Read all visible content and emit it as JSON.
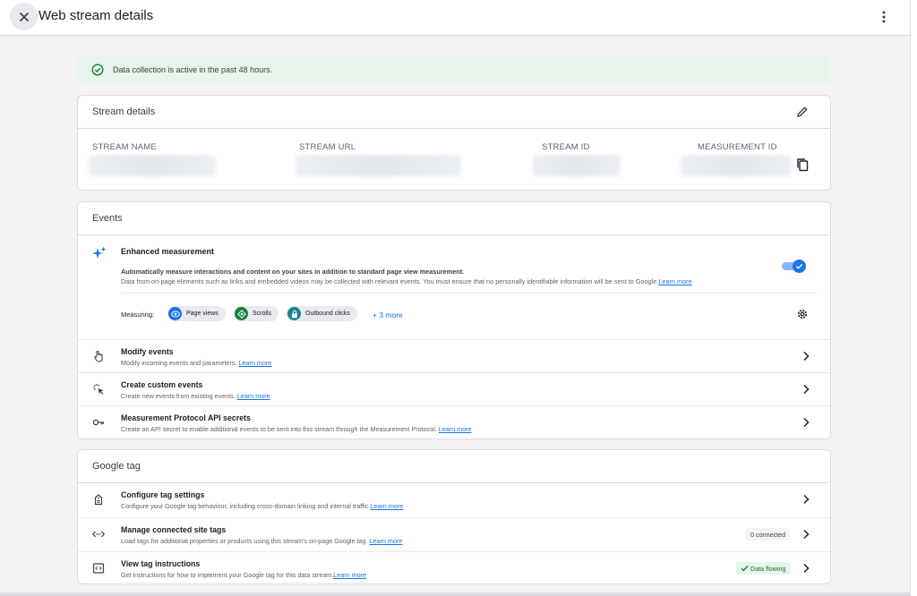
{
  "header": {
    "title": "Web stream details"
  },
  "banner": {
    "text": "Data collection is active in the past 48 hours."
  },
  "stream_details": {
    "title": "Stream details",
    "columns": [
      {
        "label": "STREAM NAME"
      },
      {
        "label": "STREAM URL"
      },
      {
        "label": "STREAM ID"
      },
      {
        "label": "MEASUREMENT ID"
      }
    ]
  },
  "events": {
    "title": "Events",
    "enhanced": {
      "title": "Enhanced measurement",
      "desc1": "Automatically measure interactions and content on your sites in addition to standard page view measurement.",
      "desc2": "Data from on-page elements such as links and embedded videos may be collected with relevant events. You must ensure that no personally identifiable information will be sent to Google.",
      "learn_more": "Learn more",
      "enabled": true,
      "measuring_label": "Measuring:",
      "chips": [
        {
          "label": "Page views",
          "color": "#1a73e8",
          "icon": "eye-icon"
        },
        {
          "label": "Scrolls",
          "color": "#188038",
          "icon": "scroll-icon"
        },
        {
          "label": "Outbound clicks",
          "color": "#12848a",
          "icon": "lock-icon"
        }
      ],
      "more": "+ 3 more"
    },
    "rows": [
      {
        "title": "Modify events",
        "desc": "Modify incoming events and parameters.",
        "link": "Learn more",
        "icon": "touch-icon"
      },
      {
        "title": "Create custom events",
        "desc": "Create new events from existing events.",
        "link": "Learn more",
        "icon": "sparkle-click-icon"
      },
      {
        "title": "Measurement Protocol API secrets",
        "desc": "Create an API secret to enable additional events to be sent into this stream through the Measurement Protocol.",
        "link": "Learn more",
        "icon": "key-icon"
      }
    ]
  },
  "google_tag": {
    "title": "Google tag",
    "rows": [
      {
        "title": "Configure tag settings",
        "desc": "Configure your Google tag behaviour, including cross-domain linking and internal traffic.",
        "link": "Learn more",
        "icon": "tag-icon"
      },
      {
        "title": "Manage connected site tags",
        "desc": "Load tags for additional properties or products using this stream's on-page Google tag.",
        "link": "Learn more",
        "icon": "code-arrows-icon",
        "badge": "0 connected"
      },
      {
        "title": "View tag instructions",
        "desc": "Get instructions for how to implement your Google tag for this data stream.",
        "link": "Learn more",
        "icon": "code-window-icon",
        "badge": "Data flowing"
      }
    ]
  }
}
